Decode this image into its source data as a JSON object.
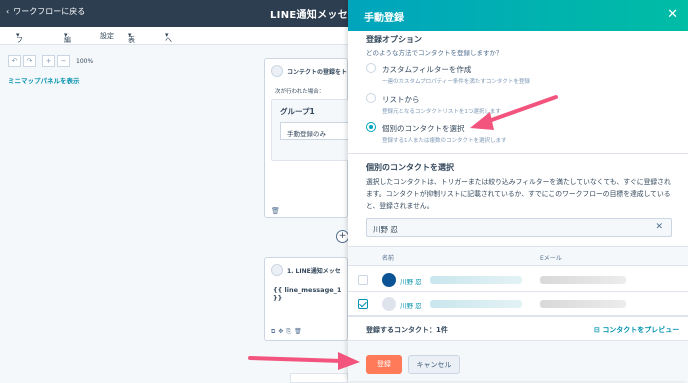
{
  "topbar": {
    "back_label": "ワークフローに戻る",
    "title": "LINE通知メッセー"
  },
  "menu": {
    "file": "ファイル",
    "edit": "編集",
    "settings": "設定",
    "view": "表示",
    "help": "ヘルプ"
  },
  "canvas": {
    "zoom": "100%",
    "minimap": "ミニマップパネルを表示"
  },
  "node1": {
    "title": "コンテクトの登録をト",
    "condition": "次が行われた場合：",
    "group_title": "グループ1",
    "group_item": "手動登録のみ"
  },
  "node2": {
    "title": "1. LINE通知メッセ",
    "body": "{{ line_message_1 }}"
  },
  "panel": {
    "title": "手動登録",
    "options_heading": "登録オプション",
    "options_question": "どのような方法でコンタクトを登録しますか？",
    "options": [
      {
        "label": "カスタムフィルターを作成",
        "desc": "一連のカスタムプロパティー条件を満たすコンタクトを登録",
        "selected": false
      },
      {
        "label": "リストから",
        "desc": "登録元となるコンタクトリストを1つ選択します",
        "selected": false
      },
      {
        "label": "個別のコンタクトを選択",
        "desc": "登録する1人または複数のコンタクトを選択します",
        "selected": true
      }
    ],
    "individual_heading": "個別のコンタクトを選択",
    "individual_desc": "選択したコンタクトは、トリガーまたは絞り込みフィルターを満たしていなくても、すぐに登録されます。コンタクトが抑制リストに記載されているか、すでにこのワークフローの目標を達成していると、登録されません。",
    "search_value": "川野 忍",
    "col_name": "名前",
    "col_email": "Eメール",
    "rows": [
      {
        "name": "川野 忍",
        "checked": false
      },
      {
        "name": "川野 忍",
        "checked": true
      }
    ],
    "count_label": "登録するコンタクト：1件",
    "preview_link": "コンタクトをプレビュー",
    "register_button": "登録",
    "cancel_button": "キャンセル"
  },
  "colors": {
    "header": "#2d3e50",
    "accent": "#00a4bd",
    "primary_button": "#ff7a59",
    "annotation_arrow": "#f2547d"
  }
}
